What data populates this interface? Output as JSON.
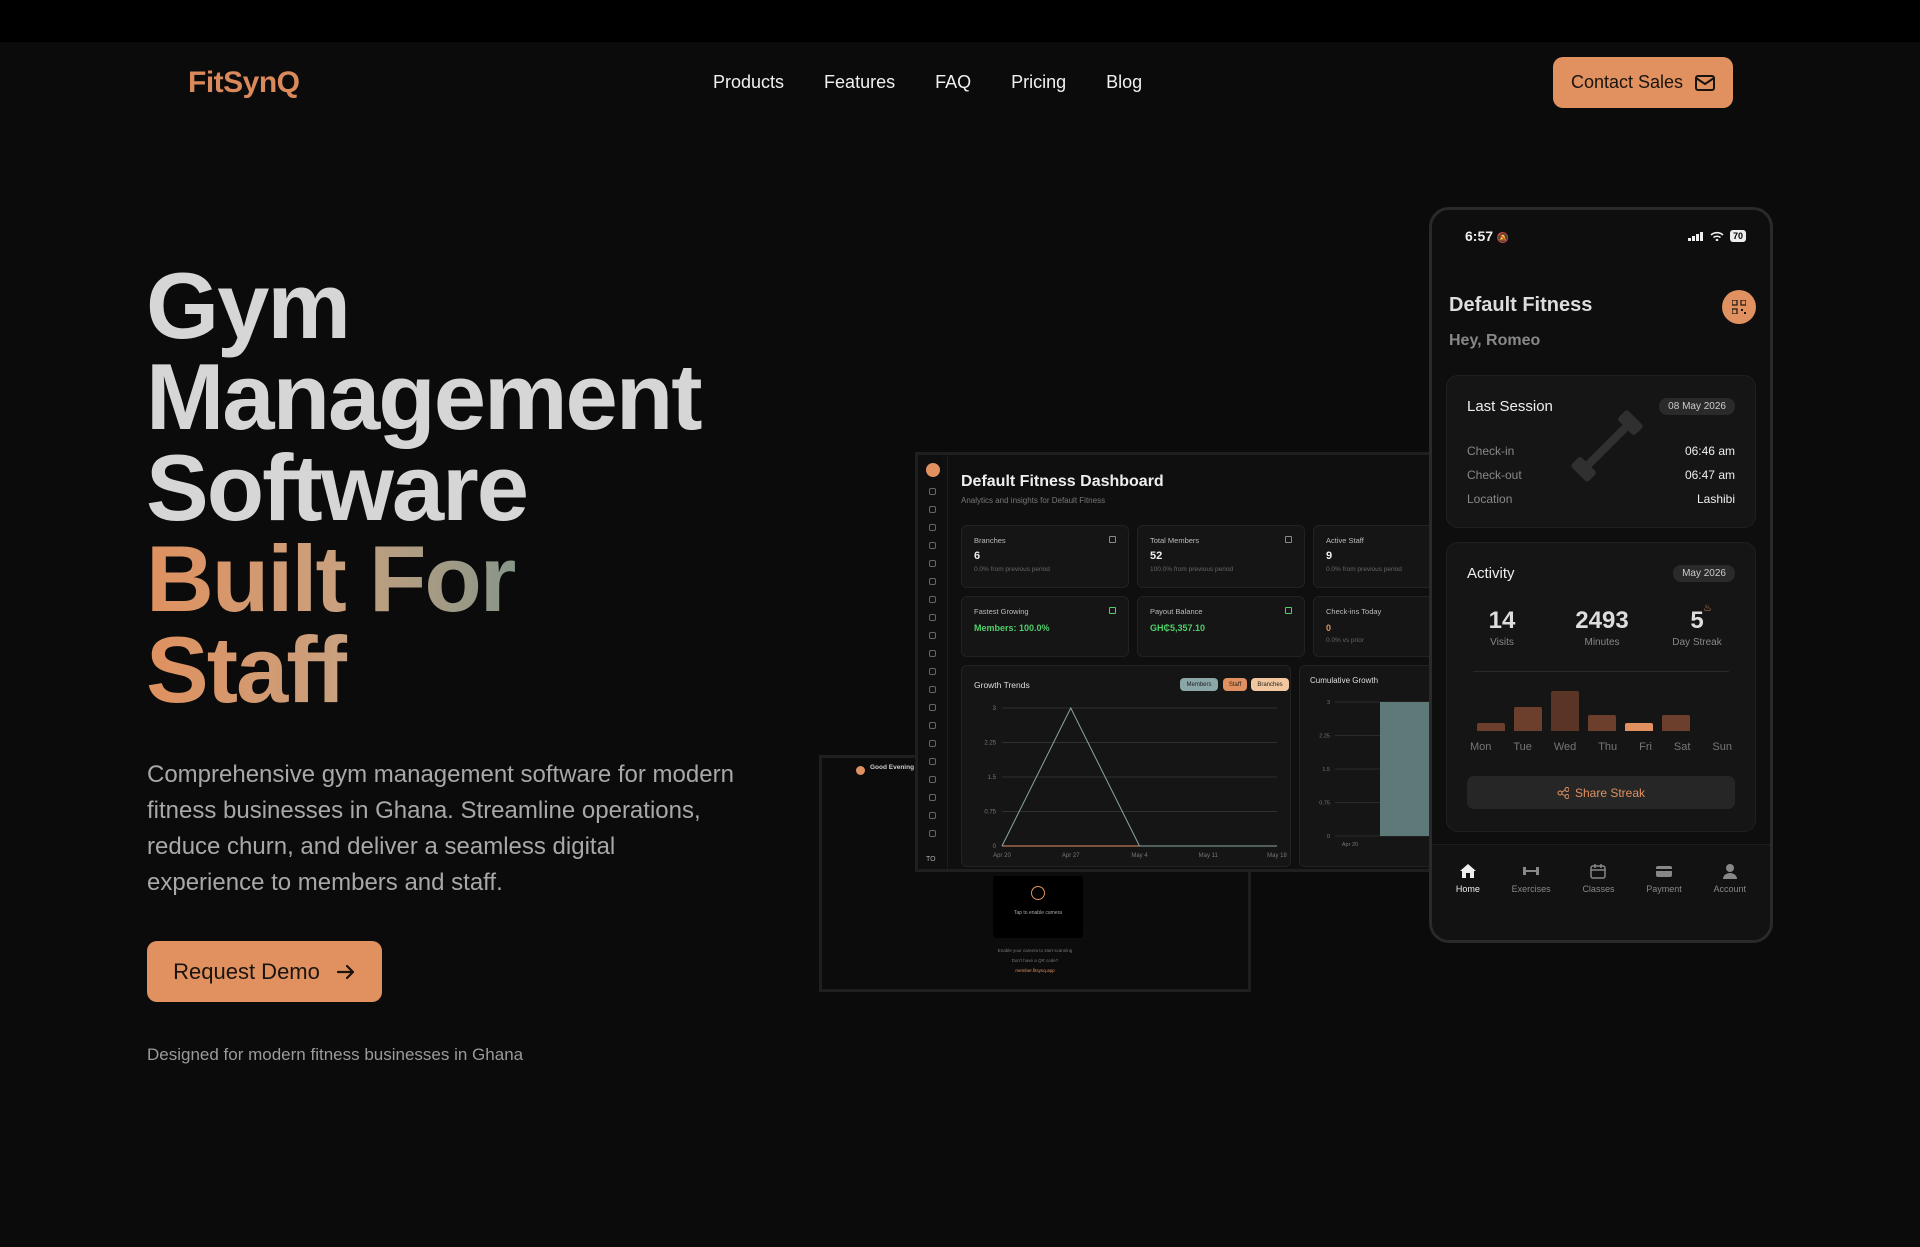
{
  "brand": {
    "logo": "FitSynQ"
  },
  "nav": {
    "items": [
      "Products",
      "Features",
      "FAQ",
      "Pricing",
      "Blog"
    ],
    "contact_label": "Contact Sales"
  },
  "hero": {
    "title_lines": [
      "Gym",
      "Management",
      "Software"
    ],
    "title_accent_lines": [
      "Built For",
      "Staff"
    ],
    "description": "Comprehensive gym management software for modern fitness businesses in Ghana. Streamline operations, reduce churn, and deliver a seamless digital experience to members and staff.",
    "cta_label": "Request Demo",
    "tagline": "Designed for modern fitness businesses in Ghana"
  },
  "dashboard": {
    "title": "Default Fitness Dashboard",
    "subtitle": "Analytics and insights for Default Fitness",
    "cards": [
      {
        "label": "Branches",
        "value": "6",
        "sub": "0.0% from previous period"
      },
      {
        "label": "Total Members",
        "value": "52",
        "sub": "100.0% from previous period"
      },
      {
        "label": "Active Staff",
        "value": "9",
        "sub": "0.0% from previous period"
      },
      {
        "label": "Fastest Growing",
        "value": "Members: 100.0%",
        "sub": ""
      },
      {
        "label": "Payout Balance",
        "value": "GH₵5,357.10",
        "sub": ""
      },
      {
        "label": "Check-ins Today",
        "value": "0",
        "sub": "0.0% vs prior"
      }
    ],
    "growth": {
      "title": "Growth Trends",
      "pills": [
        "Members",
        "Staff",
        "Branches"
      ],
      "y_ticks": [
        "3",
        "2.25",
        "1.5",
        "0.75",
        "0"
      ],
      "x_ticks": [
        "Apr 20",
        "Apr 27",
        "May 4",
        "May 11",
        "May 18"
      ]
    },
    "cumulative": {
      "title": "Cumulative Growth",
      "y_ticks": [
        "3",
        "2.25",
        "1.5",
        "0.75",
        "0"
      ],
      "x_ticks": [
        "Apr 20",
        "Apr"
      ]
    },
    "sidebar_badge": "TO"
  },
  "kiosk": {
    "greeting": "Good Evening",
    "camera_text": "Tap to enable camera",
    "hint": "Enable your camera to start scanning",
    "no_qr": "Don't have a QR code?",
    "link": "member.fitsynq.app"
  },
  "chart_data": {
    "type": "line",
    "title": "Growth Trends",
    "categories": [
      "Apr 20",
      "Apr 27",
      "May 4",
      "May 11",
      "May 18"
    ],
    "series": [
      {
        "name": "Members",
        "values": [
          0,
          3,
          0,
          0,
          0
        ]
      },
      {
        "name": "Staff",
        "values": [
          0,
          0,
          0,
          0,
          0
        ]
      },
      {
        "name": "Branches",
        "values": [
          0,
          0,
          0,
          0,
          0
        ]
      }
    ],
    "ylim": [
      0,
      3
    ]
  },
  "phone": {
    "time": "6:57",
    "battery": "70",
    "gym_name": "Default Fitness",
    "greeting": "Hey, Romeo",
    "last_session": {
      "title": "Last Session",
      "date": "08 May 2026",
      "rows": [
        {
          "k": "Check-in",
          "v": "06:46 am"
        },
        {
          "k": "Check-out",
          "v": "06:47 am"
        },
        {
          "k": "Location",
          "v": "Lashibi"
        }
      ]
    },
    "activity": {
      "title": "Activity",
      "month": "May 2026",
      "stats": [
        {
          "n": "14",
          "c": "Visits"
        },
        {
          "n": "2493",
          "c": "Minutes"
        },
        {
          "n": "5",
          "c": "Day Streak"
        }
      ],
      "days": [
        "Mon",
        "Tue",
        "Wed",
        "Thu",
        "Fri",
        "Sat",
        "Sun"
      ],
      "bar_levels": [
        0.2,
        0.6,
        1.0,
        0.4,
        0.2,
        0.4,
        0
      ],
      "share_label": "Share Streak"
    },
    "tabs": [
      "Home",
      "Exercises",
      "Classes",
      "Payment",
      "Account"
    ]
  },
  "colors": {
    "accent": "#e0915f",
    "background": "#0b0b0b",
    "green": "#4fcf6a"
  }
}
